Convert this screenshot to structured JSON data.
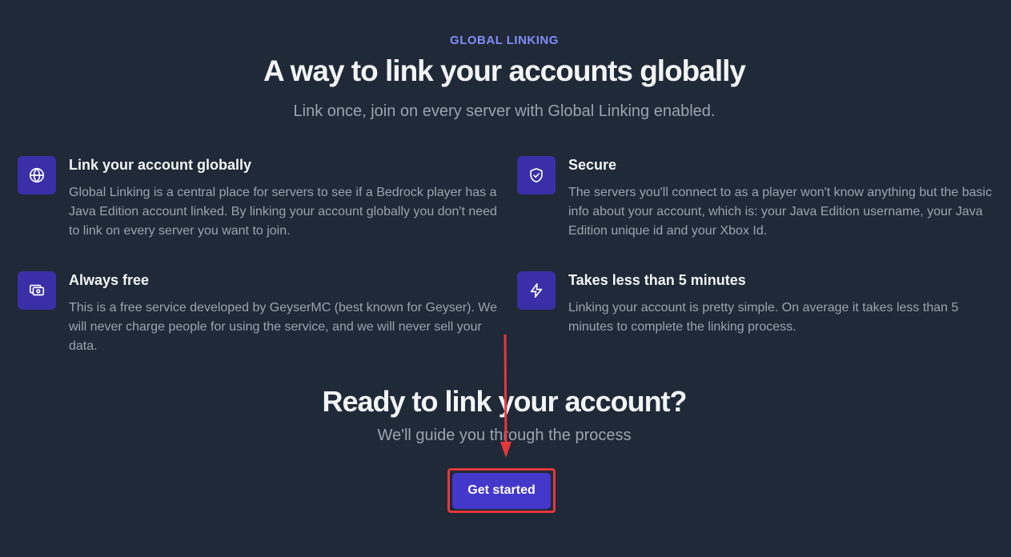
{
  "header": {
    "eyebrow": "GLOBAL LINKING",
    "title": "A way to link your accounts globally",
    "subtitle": "Link once, join on every server with Global Linking enabled."
  },
  "features": [
    {
      "icon": "globe-icon",
      "title": "Link your account globally",
      "description": "Global Linking is a central place for servers to see if a Bedrock player has a Java Edition account linked. By linking your account globally you don't need to link on every server you want to join."
    },
    {
      "icon": "shield-check-icon",
      "title": "Secure",
      "description": "The servers you'll connect to as a player won't know anything but the basic info about your account, which is: your Java Edition username, your Java Edition unique id and your Xbox Id."
    },
    {
      "icon": "cash-icon",
      "title": "Always free",
      "description": "This is a free service developed by GeyserMC (best known for Geyser). We will never charge people for using the service, and we will never sell your data."
    },
    {
      "icon": "lightning-bolt-icon",
      "title": "Takes less than 5 minutes",
      "description": "Linking your account is pretty simple. On average it takes less than 5 minutes to complete the linking process."
    }
  ],
  "cta": {
    "title": "Ready to link your account?",
    "subtitle": "We'll guide you through the process",
    "button_label": "Get started"
  },
  "colors": {
    "background": "#1f2937",
    "accent": "#4338ca",
    "icon_box": "#3b2fa8",
    "eyebrow": "#818cf8",
    "annotation": "#e5383b"
  }
}
